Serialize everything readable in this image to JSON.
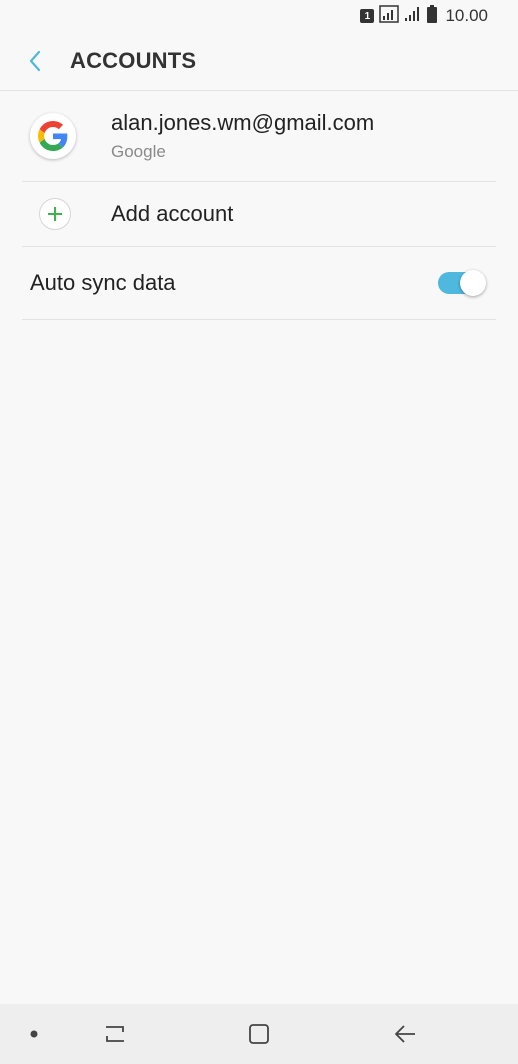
{
  "status_bar": {
    "sim_label": "1",
    "time": "10.00",
    "icons": [
      "sim-icon",
      "wifi-calling-icon",
      "signal-icon",
      "battery-icon"
    ]
  },
  "app_bar": {
    "title": "ACCOUNTS",
    "back_icon": "chevron-left-icon"
  },
  "accounts": [
    {
      "email": "alan.jones.wm@gmail.com",
      "provider": "Google",
      "icon": "google-logo-icon"
    }
  ],
  "add_account": {
    "label": "Add account",
    "icon": "plus-icon"
  },
  "auto_sync": {
    "label": "Auto sync data",
    "enabled": true
  },
  "nav_bar": {
    "items": [
      "dot-icon",
      "recents-icon",
      "home-icon",
      "back-icon"
    ]
  },
  "colors": {
    "accent": "#4fb8de",
    "add_green": "#3fb34f",
    "background": "#f8f8f8",
    "nav_bg": "#eeeeee"
  }
}
